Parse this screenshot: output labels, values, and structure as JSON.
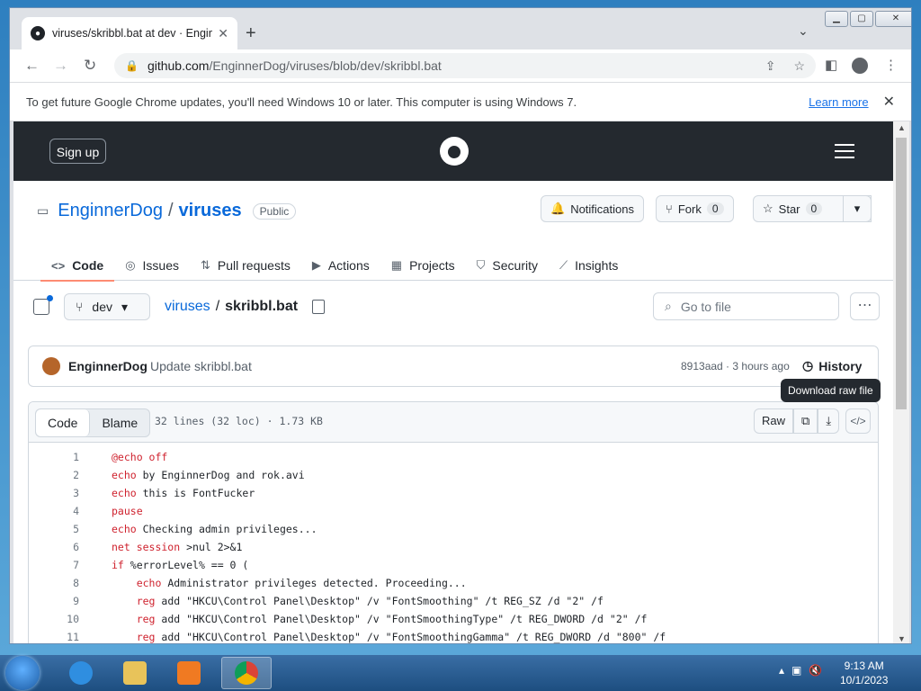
{
  "browser": {
    "tab_title": "viruses/skribbl.bat at dev · Enginn",
    "url_host": "github.com",
    "url_path": "/EnginnerDog/viruses/blob/dev/skribbl.bat",
    "infobar_message": "To get future Google Chrome updates, you'll need Windows 10 or later. This computer is using Windows 7.",
    "infobar_link": "Learn more"
  },
  "github": {
    "signup": "Sign up",
    "owner": "EnginnerDog",
    "slash": "/",
    "repo": "viruses",
    "visibility": "Public",
    "notifications": "Notifications",
    "fork_label": "Fork",
    "fork_count": "0",
    "star_label": "Star",
    "star_count": "0",
    "nav": [
      "Code",
      "Issues",
      "Pull requests",
      "Actions",
      "Projects",
      "Security",
      "Insights"
    ],
    "branch": "dev",
    "crumb_repo": "viruses",
    "crumb_sep": "/",
    "crumb_file": "skribbl.bat",
    "go_to_file_placeholder": "Go to file"
  },
  "commit": {
    "author": "EnginnerDog",
    "message": "Update skribbl.bat",
    "meta": "8913aad · 3 hours ago",
    "history": "History"
  },
  "tooltip": "Download raw file",
  "code": {
    "tab_code": "Code",
    "tab_blame": "Blame",
    "info": "32 lines (32 loc) · 1.73 KB",
    "raw": "Raw",
    "lines": [
      {
        "n": "1",
        "kw": "@echo off",
        "rest": ""
      },
      {
        "n": "2",
        "kw": "echo",
        "rest": " by EnginnerDog and rok.avi"
      },
      {
        "n": "3",
        "kw": "echo",
        "rest": " this is FontFucker"
      },
      {
        "n": "4",
        "kw": "pause",
        "rest": ""
      },
      {
        "n": "5",
        "kw": "echo",
        "rest": " Checking admin privileges..."
      },
      {
        "n": "6",
        "kw": "net session",
        "rest": " >nul 2>&1"
      },
      {
        "n": "7",
        "kw": "if",
        "rest": " %errorLevel% == 0 ("
      },
      {
        "n": "8",
        "kw": "    echo",
        "rest": " Administrator privileges detected. Proceeding..."
      },
      {
        "n": "9",
        "kw": "    reg",
        "rest": " add \"HKCU\\Control Panel\\Desktop\" /v \"FontSmoothing\" /t REG_SZ /d \"2\" /f"
      },
      {
        "n": "10",
        "kw": "    reg",
        "rest": " add \"HKCU\\Control Panel\\Desktop\" /v \"FontSmoothingType\" /t REG_DWORD /d \"2\" /f"
      },
      {
        "n": "11",
        "kw": "    reg",
        "rest": " add \"HKCU\\Control Panel\\Desktop\" /v \"FontSmoothingGamma\" /t REG_DWORD /d \"800\" /f"
      }
    ]
  },
  "taskbar": {
    "time": "9:13 AM",
    "date": "10/1/2023"
  },
  "colors": {
    "gh_header": "#24292f",
    "link_blue": "#0969da",
    "keyword_red": "#cf222e"
  }
}
